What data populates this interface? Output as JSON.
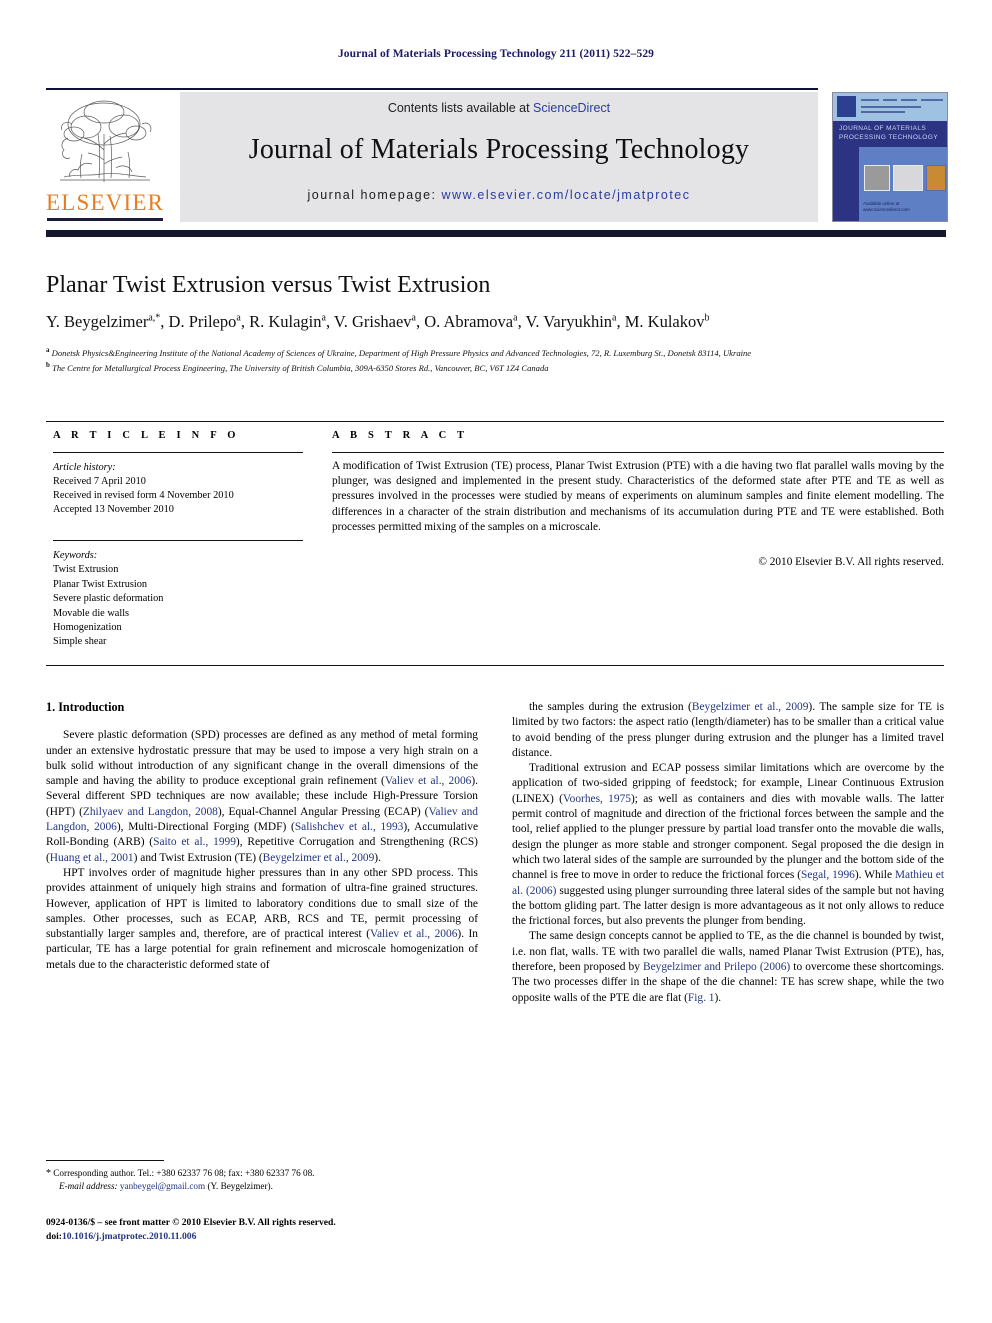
{
  "running_head": "Journal of Materials Processing Technology 211 (2011) 522–529",
  "masthead": {
    "contents_prefix": "Contents lists available at ",
    "sciencedirect": "ScienceDirect",
    "journal_title": "Journal of Materials Processing Technology",
    "homepage_label": "journal homepage:",
    "homepage_url": "www.elsevier.com/locate/jmatprotec",
    "publisher_wordmark": "ELSEVIER",
    "cover_title": "JOURNAL OF MATERIALS PROCESSING TECHNOLOGY",
    "cover_footer": "Available online at www.sciencedirect.com",
    "colors": {
      "banner_bg": "#e4e4e7",
      "link_blue": "#2a3b9e",
      "elsevier_orange": "#e87e22",
      "cover_navy": "#2b3382",
      "cover_light": "#9fc2e2",
      "rule_dark": "#16162e"
    }
  },
  "article": {
    "title": "Planar Twist Extrusion versus Twist Extrusion",
    "authors_html": "Y. Beygelzimer<sup>a,*</sup>, D. Prilepo<sup>a</sup>, R. Kulagin<sup>a</sup>, V. Grishaev<sup>a</sup>, O. Abramova<sup>a</sup>, V. Varyukhin<sup>a</sup>, M. Kulakov<sup>b</sup>",
    "affiliation_a": "Donetsk Physics&Engineering Institute of the National Academy of Sciences of Ukraine, Department of High Pressure Physics and Advanced Technologies, 72, R. Luxemburg St., Donetsk 83114, Ukraine",
    "affiliation_b": "The Centre for Metallurgical Process Engineering, The University of British Columbia, 309A-6350 Stores Rd., Vancouver, BC, V6T 1Z4 Canada"
  },
  "info": {
    "heading": "A R T I C L E    I N F O",
    "history_label": "Article history:",
    "history": [
      "Received 7 April 2010",
      "Received in revised form 4 November 2010",
      "Accepted 13 November 2010"
    ],
    "keywords_label": "Keywords:",
    "keywords": [
      "Twist Extrusion",
      "Planar Twist Extrusion",
      "Severe plastic deformation",
      "Movable die walls",
      "Homogenization",
      "Simple shear"
    ]
  },
  "abstract": {
    "heading": "A B S T R A C T",
    "text": "A modification of Twist Extrusion (TE) process, Planar Twist Extrusion (PTE) with a die having two flat parallel walls moving by the plunger, was designed and implemented in the present study. Characteristics of the deformed state after PTE and TE as well as pressures involved in the processes were studied by means of experiments on aluminum samples and finite element modelling. The differences in a character of the strain distribution and mechanisms of its accumulation during PTE and TE were established. Both processes permitted mixing of the samples on a microscale.",
    "copyright": "© 2010 Elsevier B.V. All rights reserved."
  },
  "body": {
    "section_number_title": "1.  Introduction",
    "left_paragraphs": [
      {
        "runs": [
          {
            "t": "Severe plastic deformation (SPD) processes are defined as any method of metal forming under an extensive hydrostatic pressure that may be used to impose a very high strain on a bulk solid without introduction of any significant change in the overall dimensions of the sample and having the ability to produce exceptional grain refinement ("
          },
          {
            "t": "Valiev et al., 2006",
            "r": true
          },
          {
            "t": "). Several different SPD techniques are now available; these include High-Pressure Torsion (HPT) ("
          },
          {
            "t": "Zhilyaev and Langdon, 2008",
            "r": true
          },
          {
            "t": "), Equal-Channel Angular Pressing (ECAP) ("
          },
          {
            "t": "Valiev and Langdon, 2006",
            "r": true
          },
          {
            "t": "), Multi-Directional Forging (MDF) ("
          },
          {
            "t": "Salishchev et al., 1993",
            "r": true
          },
          {
            "t": "), Accumulative Roll-Bonding (ARB) ("
          },
          {
            "t": "Saito et al., 1999",
            "r": true
          },
          {
            "t": "), Repetitive Corrugation and Strengthening (RCS) ("
          },
          {
            "t": "Huang et al., 2001",
            "r": true
          },
          {
            "t": ") and Twist Extrusion (TE) ("
          },
          {
            "t": "Beygelzimer et al., 2009",
            "r": true
          },
          {
            "t": ")."
          }
        ]
      },
      {
        "runs": [
          {
            "t": "HPT involves order of magnitude higher pressures than in any other SPD process. This provides attainment of uniquely high strains and formation of ultra-fine grained structures. However, application of HPT is limited to laboratory conditions due to small size of the samples. Other processes, such as ECAP, ARB, RCS and TE, permit processing of substantially larger samples and, therefore, are of practical interest ("
          },
          {
            "t": "Valiev et al., 2006",
            "r": true
          },
          {
            "t": "). In particular, TE has a large potential for grain refinement and microscale homogenization of metals due to the characteristic deformed state of"
          }
        ]
      }
    ],
    "right_paragraphs": [
      {
        "runs": [
          {
            "t": "the samples during the extrusion ("
          },
          {
            "t": "Beygelzimer et al., 2009",
            "r": true
          },
          {
            "t": "). The sample size for TE is limited by two factors: the aspect ratio (length/diameter) has to be smaller than a critical value to avoid bending of the press plunger during extrusion and the plunger has a limited travel distance."
          }
        ],
        "no_indent": false
      },
      {
        "runs": [
          {
            "t": "Traditional extrusion and ECAP possess similar limitations which are overcome by the application of two-sided gripping of feedstock; for example, Linear Continuous Extrusion (LINEX) ("
          },
          {
            "t": "Voorhes, 1975",
            "r": true
          },
          {
            "t": "); as well as containers and dies with movable walls. The latter permit control of magnitude and direction of the frictional forces between the sample and the tool, relief applied to the plunger pressure by partial load transfer onto the movable die walls, design the plunger as more stable and stronger component. Segal proposed the die design in which two lateral sides of the sample are surrounded by the plunger and the bottom side of the channel is free to move in order to reduce the frictional forces ("
          },
          {
            "t": "Segal, 1996",
            "r": true
          },
          {
            "t": "). While "
          },
          {
            "t": "Mathieu et al. (2006)",
            "r": true
          },
          {
            "t": " suggested using plunger surrounding three lateral sides of the sample but not having the bottom gliding part. The latter design is more advantageous as it not only allows to reduce the frictional forces, but also prevents the plunger from bending."
          }
        ]
      },
      {
        "runs": [
          {
            "t": "The same design concepts cannot be applied to TE, as the die channel is bounded by twist, i.e. non flat, walls. TE with two parallel die walls, named Planar Twist Extrusion (PTE), has, therefore, been proposed by "
          },
          {
            "t": "Beygelzimer and Prilepo (2006)",
            "r": true
          },
          {
            "t": " to overcome these shortcomings. The two processes differ in the shape of the die channel: TE has screw shape, while the two opposite walls of the PTE die are flat ("
          },
          {
            "t": "Fig. 1",
            "r": true
          },
          {
            "t": ")."
          }
        ]
      }
    ]
  },
  "footer": {
    "corresponding_marker": "*",
    "corresponding": " Corresponding author. Tel.: +380 62337 76 08; fax: +380 62337 76 08.",
    "email_label": "E-mail address:",
    "email": "yanbeygel@gmail.com",
    "email_owner": "(Y. Beygelzimer).",
    "imprint": "0924-0136/$ – see front matter © 2010 Elsevier B.V. All rights reserved.",
    "doi_label": "doi:",
    "doi": "10.1016/j.jmatprotec.2010.11.006"
  }
}
